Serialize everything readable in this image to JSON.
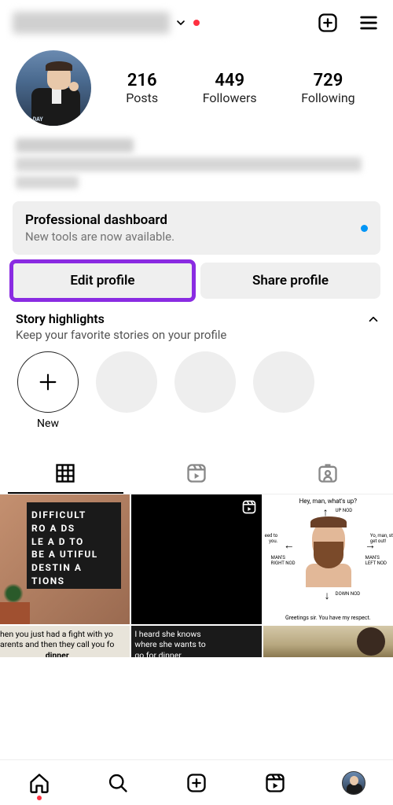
{
  "header": {
    "username_hidden": true
  },
  "stats": {
    "posts_count": "216",
    "posts_label": "Posts",
    "followers_count": "449",
    "followers_label": "Followers",
    "following_count": "729",
    "following_label": "Following"
  },
  "dashboard": {
    "title": "Professional dashboard",
    "subtitle": "New tools are now available."
  },
  "buttons": {
    "edit": "Edit profile",
    "share": "Share profile"
  },
  "highlights": {
    "title": "Story highlights",
    "subtitle": "Keep your favorite stories on your profile",
    "new_label": "New"
  },
  "grid": {
    "c1_l1": "DIFFICULT",
    "c1_l2": "RO A DS",
    "c1_l3": "LE A D  TO",
    "c1_l4": "BE A UTIFUL",
    "c1_l5": "DESTIN A TIONS",
    "c3_top": "Hey, man, what's up?",
    "c3_up": "UP NOD",
    "c3_left1": "eed to",
    "c3_left2": "you.",
    "c3_right1": "Yo, man, st",
    "c3_right2": "get out!",
    "c3_ml": "MAN'S",
    "c3_ml2": "RIGHT NOD",
    "c3_mr": "MAN'S",
    "c3_mr2": "LEFT NOD",
    "c3_down": "DOWN NOD",
    "c3_bottom": "Greetings sir. You have my respect.",
    "c4_line1": "hen you just had a fight with yo",
    "c4_line2": "arents and then they call you fo",
    "c4_bold": "dinner",
    "c5_line1": "I heard she knows",
    "c5_line2": "where she wants to",
    "c5_line3": "go for dinner."
  }
}
